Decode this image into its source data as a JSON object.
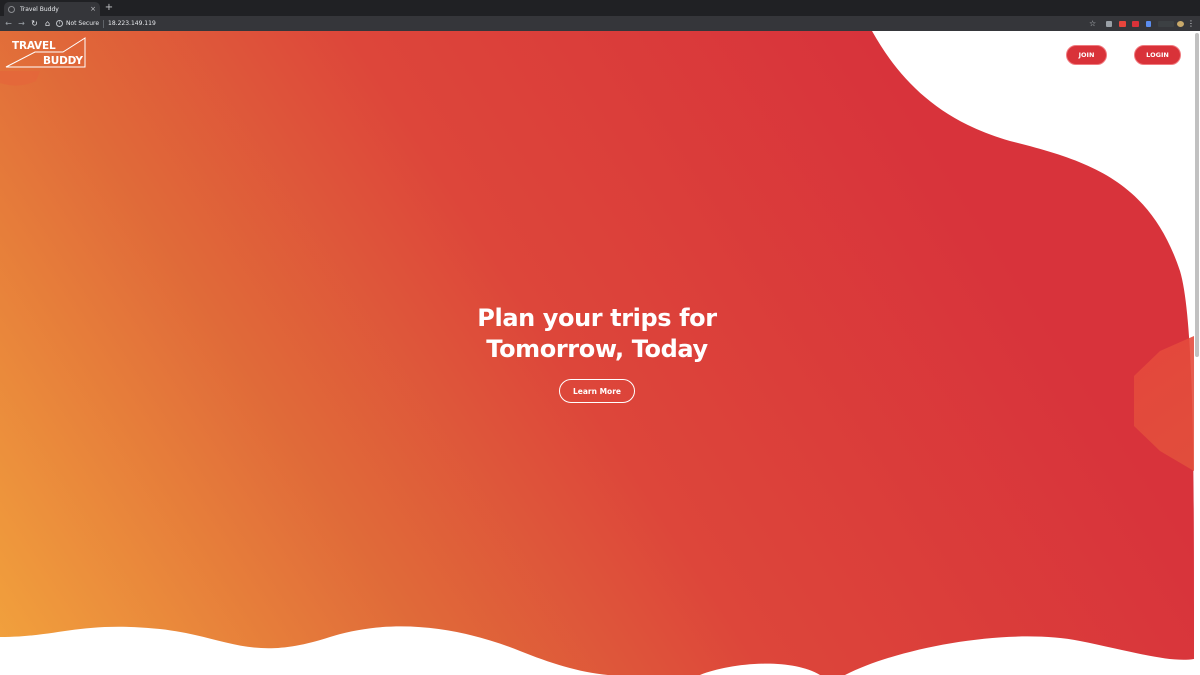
{
  "browser": {
    "tab_title": "Travel Buddy",
    "tab_close": "×",
    "new_tab": "+",
    "security_label": "Not Secure",
    "url": "18.223.149.119"
  },
  "header": {
    "logo_line1": "TRAVEL",
    "logo_line2": "BUDDY",
    "join_label": "JOIN",
    "login_label": "LOGIN"
  },
  "hero": {
    "title_line1": "Plan your trips for",
    "title_line2": "Tomorrow, Today",
    "cta_label": "Learn More"
  },
  "colors": {
    "gradient_orange": "#f2a33d",
    "gradient_mid": "#e0573a",
    "gradient_red": "#d8333b",
    "button_red": "#d93239"
  },
  "icons": {
    "back": "arrow-left",
    "forward": "arrow-right",
    "reload": "reload",
    "home": "home",
    "info": "info",
    "bookmark": "star"
  }
}
